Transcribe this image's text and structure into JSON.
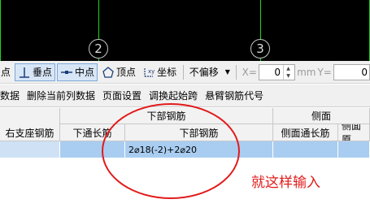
{
  "viewport": {
    "axis_labels": [
      "2",
      "3"
    ]
  },
  "snap_toolbar": {
    "items": [
      {
        "label": "点",
        "icon": "endpoint-snap-icon",
        "active": false
      },
      {
        "label": "垂点",
        "icon": "perpendicular-snap-icon",
        "active": true
      },
      {
        "label": "中点",
        "icon": "midpoint-snap-icon",
        "active": true
      },
      {
        "label": "顶点",
        "icon": "vertex-snap-icon",
        "active": false
      },
      {
        "label": "坐标",
        "icon": "coordinate-snap-icon",
        "active": false
      }
    ],
    "offset_select": "不偏移",
    "x_label": "X=",
    "x_value": "0",
    "unit": "mm",
    "y_label": "Y=",
    "y_value": "0"
  },
  "menu": {
    "items": [
      "数据",
      "删除当前列数据",
      "页面设置",
      "调换起始跨",
      "悬臂钢筋代号"
    ]
  },
  "grid": {
    "group_headers": {
      "lower_rebar": "下部钢筋",
      "side": "侧面"
    },
    "columns": [
      "右支座钢筋",
      "下通长筋",
      "下部钢筋",
      "侧面通长筋",
      "侧面原"
    ],
    "row": {
      "lower_rebar_value": "2⌀18(-2)+2⌀20"
    }
  },
  "annotation": {
    "note": "就这样输入",
    "color": "#e21b1b"
  },
  "colors": {
    "accent": "#1fd51f",
    "selection": "#a9cdf0"
  }
}
